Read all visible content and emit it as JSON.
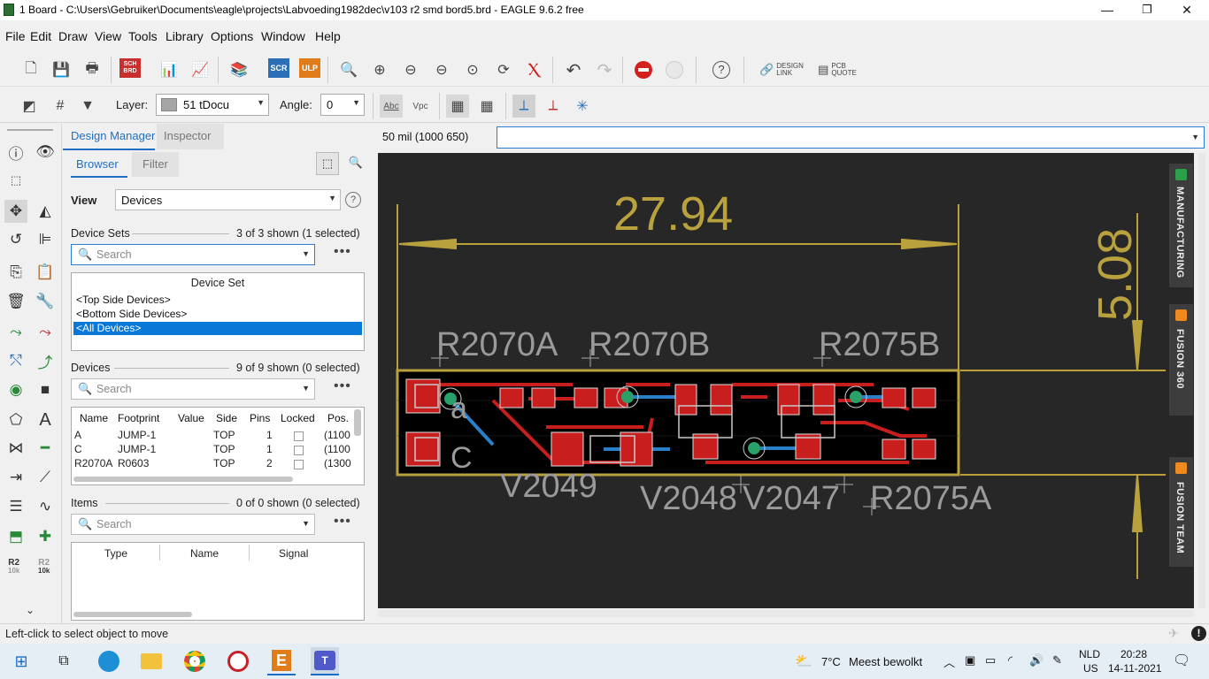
{
  "titlebar": {
    "title": "1 Board - C:\\Users\\Gebruiker\\Documents\\eagle\\projects\\Labvoeding1982dec\\v103 r2 smd bord5.brd - EAGLE 9.6.2 free",
    "minimize": "—",
    "restore": "❐",
    "close": "✕"
  },
  "menu": [
    "File",
    "Edit",
    "Draw",
    "View",
    "Tools",
    "Library",
    "Options",
    "Window",
    "Help"
  ],
  "toolbar1": {
    "design_link": "DESIGN\nLINK",
    "pcb_quote": "PCB\nQUOTE",
    "sch_brd": "SCH\nBRD",
    "scr": "SCR",
    "ulp": "ULP"
  },
  "toolbar2": {
    "layer_label": "Layer:",
    "layer_value": "51 tDocu",
    "layer_color": "#a6a6a6",
    "angle_label": "Angle:",
    "angle_value": "0",
    "abc_label": "Abc",
    "vpc_label": "Vpc"
  },
  "design_manager": {
    "tabs": [
      "Design Manager",
      "Inspector"
    ],
    "subtabs": [
      "Browser",
      "Filter"
    ],
    "view_label": "View",
    "view_value": "Devices",
    "device_sets": {
      "title": "Device Sets",
      "count": "3 of 3 shown (1 selected)",
      "search_placeholder": "Search",
      "header": "Device Set",
      "items": [
        "<Top Side Devices>",
        "<Bottom Side Devices>",
        "<All Devices>"
      ],
      "selected_index": 2
    },
    "devices": {
      "title": "Devices",
      "count": "9 of 9 shown (0 selected)",
      "search_placeholder": "Search",
      "columns": [
        "Name",
        "Footprint",
        "Value",
        "Side",
        "Pins",
        "Locked",
        "Pos."
      ],
      "rows": [
        {
          "name": "A",
          "footprint": "JUMP-1",
          "value": "",
          "side": "TOP",
          "pins": "1",
          "pos": "(1100"
        },
        {
          "name": "C",
          "footprint": "JUMP-1",
          "value": "",
          "side": "TOP",
          "pins": "1",
          "pos": "(1100"
        },
        {
          "name": "R2070A",
          "footprint": "R0603",
          "value": "",
          "side": "TOP",
          "pins": "2",
          "pos": "(1300"
        }
      ]
    },
    "items": {
      "title": "Items",
      "count": "0 of 0 shown (0 selected)",
      "search_placeholder": "Search",
      "columns": [
        "Type",
        "Name",
        "Signal"
      ]
    }
  },
  "canvas": {
    "coord_readout": "50 mil (1000 650)",
    "dim_width": "27.94",
    "dim_height": "5.08",
    "labels": {
      "r2070a": "R2070A",
      "r2070b": "R2070B",
      "r2075b": "R2075B",
      "v2049": "V2049",
      "v2048": "V2048",
      "v2047": "V2047",
      "r2075a": "R2075A",
      "a": "a",
      "c": "C"
    },
    "side_tabs": [
      "MANUFACTURING",
      "FUSION 360",
      "FUSION TEAM"
    ],
    "colors": {
      "background": "#272727",
      "dimension": "#b9a23e",
      "top_copper": "#c81e1e",
      "bottom_copper": "#2a80c8",
      "via": "#2aa06a"
    }
  },
  "status": {
    "text": "Left-click to select object to move"
  },
  "taskbar": {
    "weather_temp": "7°C",
    "weather_desc": "Meest bewolkt",
    "lang_top": "NLD",
    "lang_bottom": "US",
    "time": "20:28",
    "date": "14-11-2021"
  },
  "small_labels": {
    "r2_top": "R2",
    "r2_sub": "10k",
    "r2b_top": "R2",
    "r2b_sub": "10k"
  }
}
